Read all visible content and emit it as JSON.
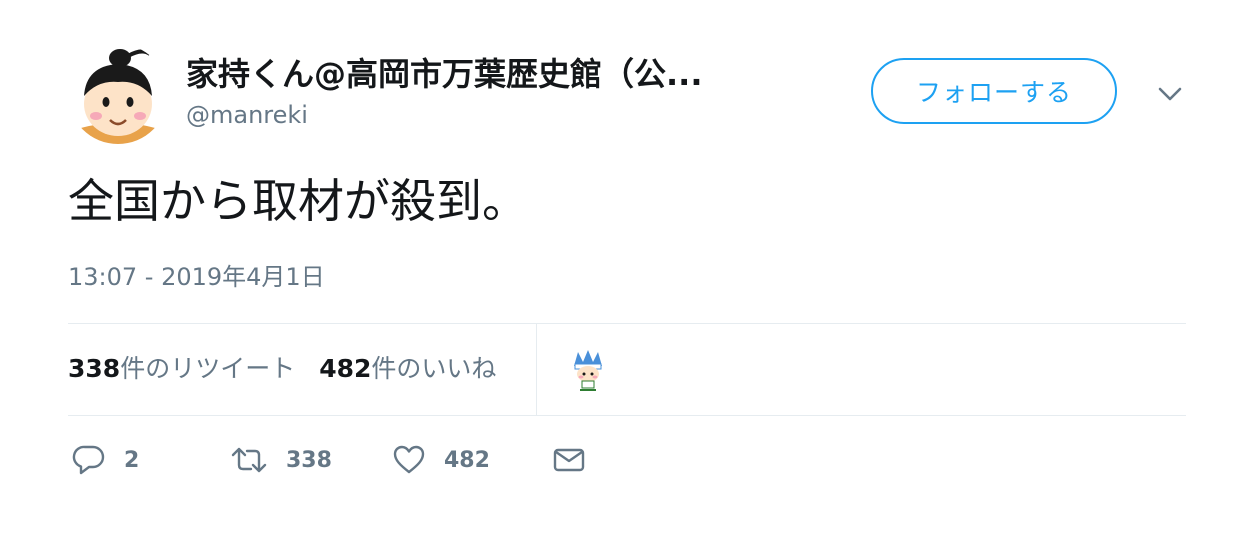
{
  "tweet": {
    "display_name": "家持くん@高岡市万葉歴史館（公...",
    "handle": "@manreki",
    "follow_label": "フォローする",
    "text": "全国から取材が殺到。",
    "timestamp": "13:07 - 2019年4月1日"
  },
  "stats": {
    "retweets_count": "338",
    "retweets_label": "件のリツイート",
    "likes_count": "482",
    "likes_label": "件のいいね"
  },
  "actions": {
    "reply_count": "2",
    "retweet_count": "338",
    "like_count": "482"
  },
  "icons": {
    "reply": "reply-icon",
    "retweet": "retweet-icon",
    "like": "heart-icon",
    "dm": "envelope-icon",
    "more": "chevron-down-icon"
  },
  "colors": {
    "accent": "#1da1f2",
    "secondary_text": "#657786",
    "primary_text": "#14171a",
    "divider": "#e6ecf0"
  }
}
